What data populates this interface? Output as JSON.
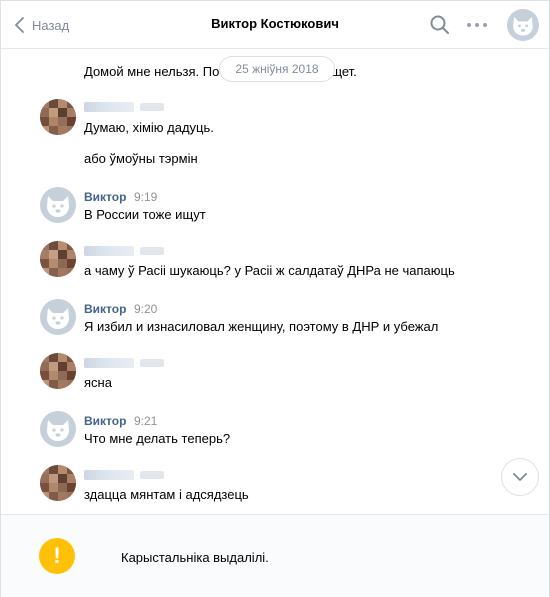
{
  "header": {
    "back_label": "Назад",
    "title": "Виктор Костюкович"
  },
  "date_separator": "25 жніўня 2018",
  "messages": [
    {
      "text": "Домой мне нельзя. По",
      "tail": "щет."
    },
    {
      "text": "Думаю, хімію дадуць."
    },
    {
      "text": "або ўмоўны тэрмін"
    },
    {
      "author": "Виктор",
      "time": "9:19",
      "text": "В России тоже ищут"
    },
    {
      "text": "а чаму ў Расіі шукаюць? у Расіі ж салдатаў ДНРа не чапаюць"
    },
    {
      "author": "Виктор",
      "time": "9:20",
      "text": "Я избил и изнасиловал женщину, поэтому в ДНР и убежал"
    },
    {
      "text": "ясна"
    },
    {
      "author": "Виктор",
      "time": "9:21",
      "text": "Что мне делать теперь?"
    },
    {
      "text": "здацца мянтам і адсядзець"
    }
  ],
  "footer": {
    "notice": "Карыстальніка выдалілі.",
    "notice_icon": "exclamation-icon",
    "icon_glyph": "!"
  },
  "colors": {
    "link": "#42648b",
    "muted": "#828a99",
    "warning": "#ffc107",
    "vk_avatar": "#c5d0db"
  }
}
